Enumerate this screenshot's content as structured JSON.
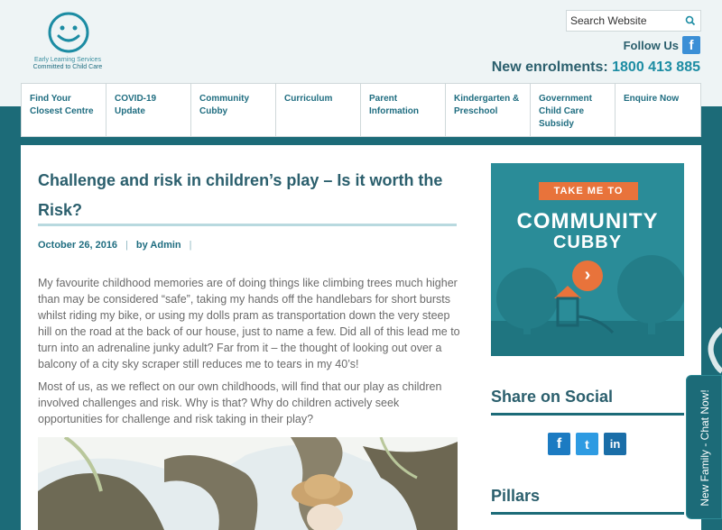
{
  "logo": {
    "line1": "Early Learning Services",
    "line2": "Committed to Child Care"
  },
  "search": {
    "placeholder": "Search Website",
    "icon": "search-icon"
  },
  "follow": {
    "label": "Follow Us",
    "icon": "facebook-icon"
  },
  "enrolments": {
    "label": "New enrolments:",
    "phone": "1800 413 885"
  },
  "nav": {
    "items": [
      {
        "label": "Find Your Closest Centre"
      },
      {
        "label": "COVID-19 Update"
      },
      {
        "label": "Community Cubby"
      },
      {
        "label": "Curriculum"
      },
      {
        "label": "Parent Information"
      },
      {
        "label": "Kindergarten & Preschool"
      },
      {
        "label": "Government Child Care Subsidy"
      },
      {
        "label": "Enquire Now"
      }
    ]
  },
  "article": {
    "title": "Challenge and risk in children’s play – Is it worth the Risk?",
    "date": "October 26, 2016",
    "author": "by Admin",
    "paragraphs": [
      "My favourite childhood memories are of doing things like climbing trees much higher than may be considered “safe”, taking my hands off the handlebars for short bursts whilst riding my bike, or using my dolls pram as transportation down the very steep hill on the road at the back of our house, just to name a few. Did all of this lead me to turn into an adrenaline junky adult? Far from it – the thought of looking out over a balcony of a city sky scraper still reduces me to tears in my 40’s!",
      "Most of us, as we reflect on our own childhoods, will find that our play as children involved challenges and risk. Why is that? Why do children actively seek opportunities for challenge and risk taking in their play?"
    ]
  },
  "promo": {
    "tag": "TAKE ME TO",
    "line1": "COMMUNITY",
    "line2": "CUBBY",
    "arrow": "›"
  },
  "share": {
    "heading": "Share on Social",
    "icons": [
      "facebook-icon",
      "twitter-icon",
      "linkedin-icon"
    ],
    "glyphs": {
      "facebook": "f",
      "twitter": "t",
      "linkedin": "in"
    }
  },
  "pillars": {
    "heading": "Pillars"
  },
  "chat": {
    "label": "New Family - Chat Now!"
  },
  "colors": {
    "teal": "#1c6b78",
    "accent": "#1c8ca3",
    "orange": "#e8733b",
    "heading": "#2b5f6d"
  }
}
